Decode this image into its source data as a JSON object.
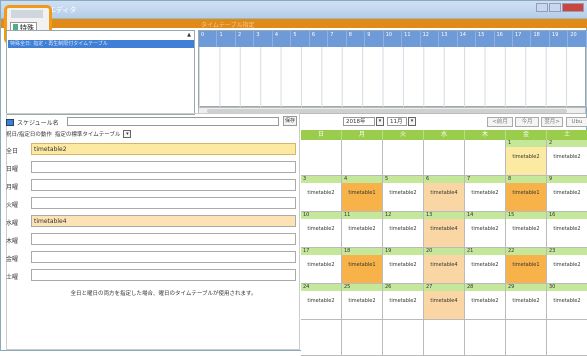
{
  "window": {
    "title": "エディタ"
  },
  "tabstrip": {
    "ghost_text": "タイムテーブル指定",
    "tab_label": "特殊"
  },
  "list": {
    "selected_row": "特殊全日:  指定・再生制限付タイムテーブル"
  },
  "timeline": {
    "hours": [
      "0",
      "1",
      "2",
      "3",
      "4",
      "5",
      "6",
      "7",
      "8",
      "9",
      "10",
      "11",
      "12",
      "13",
      "14",
      "15",
      "16",
      "17",
      "18",
      "19",
      "20"
    ]
  },
  "schedule": {
    "label": "スケジュール名",
    "name_value": "",
    "save_label": "保存"
  },
  "action": {
    "label": "祝日/指定日の動作",
    "value": "指定の標準タイムテーブル"
  },
  "days": [
    {
      "label": "全日",
      "value": "timetable2",
      "style": "alt"
    },
    {
      "label": "日曜",
      "value": "",
      "style": ""
    },
    {
      "label": "月曜",
      "value": "",
      "style": ""
    },
    {
      "label": "火曜",
      "value": "",
      "style": ""
    },
    {
      "label": "水曜",
      "value": "timetable4",
      "style": "tue"
    },
    {
      "label": "木曜",
      "value": "",
      "style": ""
    },
    {
      "label": "金曜",
      "value": "",
      "style": ""
    },
    {
      "label": "土曜",
      "value": "",
      "style": ""
    }
  ],
  "note": "全日と曜日の両方を指定した場合、曜日のタイムテーブルが使用されます。",
  "calnav": {
    "year": "2018年",
    "month": "11月",
    "prev": "<前月",
    "today": "今月",
    "next": "翌月>",
    "extra": "Ubu"
  },
  "calendar": {
    "weekdays": [
      "日",
      "月",
      "火",
      "水",
      "木",
      "金",
      "土"
    ],
    "weeks": [
      [
        {
          "d": "",
          "t": "",
          "f": "empty"
        },
        {
          "d": "",
          "t": "",
          "f": "empty"
        },
        {
          "d": "",
          "t": "",
          "f": "empty"
        },
        {
          "d": "",
          "t": "",
          "f": "empty"
        },
        {
          "d": "",
          "t": "",
          "f": "empty"
        },
        {
          "d": "1",
          "t": "timetable2",
          "f": "fill-yellow"
        },
        {
          "d": "2",
          "t": "timetable2",
          "f": ""
        }
      ],
      [
        {
          "d": "3",
          "t": "timetable2",
          "f": ""
        },
        {
          "d": "4",
          "t": "timetable1",
          "f": "fill-orange"
        },
        {
          "d": "5",
          "t": "timetable2",
          "f": ""
        },
        {
          "d": "6",
          "t": "timetable4",
          "f": "fill-peach"
        },
        {
          "d": "7",
          "t": "timetable2",
          "f": ""
        },
        {
          "d": "8",
          "t": "timetable1",
          "f": "fill-orange"
        },
        {
          "d": "9",
          "t": "timetable2",
          "f": ""
        }
      ],
      [
        {
          "d": "10",
          "t": "timetable2",
          "f": ""
        },
        {
          "d": "11",
          "t": "timetable2",
          "f": ""
        },
        {
          "d": "12",
          "t": "timetable2",
          "f": ""
        },
        {
          "d": "13",
          "t": "timetable4",
          "f": "fill-peach"
        },
        {
          "d": "14",
          "t": "timetable2",
          "f": ""
        },
        {
          "d": "15",
          "t": "timetable2",
          "f": ""
        },
        {
          "d": "16",
          "t": "timetable2",
          "f": ""
        }
      ],
      [
        {
          "d": "17",
          "t": "timetable2",
          "f": ""
        },
        {
          "d": "18",
          "t": "timetable1",
          "f": "fill-orange"
        },
        {
          "d": "19",
          "t": "timetable2",
          "f": ""
        },
        {
          "d": "20",
          "t": "timetable4",
          "f": "fill-peach"
        },
        {
          "d": "21",
          "t": "timetable2",
          "f": ""
        },
        {
          "d": "22",
          "t": "timetable1",
          "f": "fill-orange"
        },
        {
          "d": "23",
          "t": "timetable2",
          "f": ""
        }
      ],
      [
        {
          "d": "24",
          "t": "timetable2",
          "f": ""
        },
        {
          "d": "25",
          "t": "timetable2",
          "f": ""
        },
        {
          "d": "26",
          "t": "timetable2",
          "f": ""
        },
        {
          "d": "27",
          "t": "timetable4",
          "f": "fill-peach"
        },
        {
          "d": "28",
          "t": "timetable2",
          "f": ""
        },
        {
          "d": "29",
          "t": "timetable2",
          "f": ""
        },
        {
          "d": "30",
          "t": "timetable2",
          "f": ""
        }
      ],
      [
        {
          "d": "",
          "t": "",
          "f": "empty"
        },
        {
          "d": "",
          "t": "",
          "f": "empty"
        },
        {
          "d": "",
          "t": "",
          "f": "empty"
        },
        {
          "d": "",
          "t": "",
          "f": "empty"
        },
        {
          "d": "",
          "t": "",
          "f": "empty"
        },
        {
          "d": "",
          "t": "",
          "f": "empty"
        },
        {
          "d": "",
          "t": "",
          "f": "empty"
        }
      ]
    ]
  },
  "colors": {
    "accent": "#e08a1a",
    "calendar_header": "#9acd4c",
    "selection": "#3f7fd6"
  }
}
